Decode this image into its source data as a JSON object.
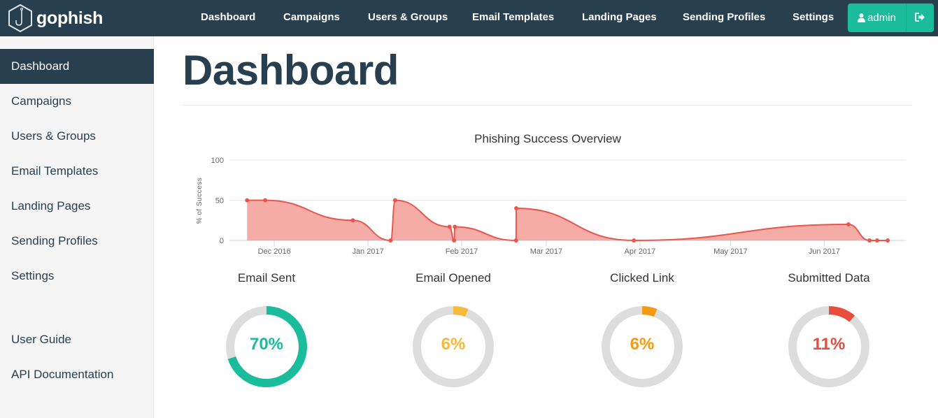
{
  "brand": {
    "name": "gophish",
    "icon": "hexagon-hook-icon"
  },
  "navbar": {
    "links": [
      {
        "label": "Dashboard"
      },
      {
        "label": "Campaigns"
      },
      {
        "label": "Users & Groups"
      },
      {
        "label": "Email Templates"
      },
      {
        "label": "Landing Pages"
      },
      {
        "label": "Sending Profiles"
      },
      {
        "label": "Settings"
      }
    ],
    "user": {
      "label": "admin",
      "icon": "user-icon"
    },
    "logout": {
      "icon": "sign-out-icon"
    }
  },
  "sidebar": {
    "items": [
      {
        "label": "Dashboard",
        "active": true
      },
      {
        "label": "Campaigns"
      },
      {
        "label": "Users & Groups"
      },
      {
        "label": "Email Templates"
      },
      {
        "label": "Landing Pages"
      },
      {
        "label": "Sending Profiles"
      },
      {
        "label": "Settings"
      }
    ],
    "footer_items": [
      {
        "label": "User Guide"
      },
      {
        "label": "API Documentation"
      }
    ]
  },
  "page": {
    "title": "Dashboard"
  },
  "colors": {
    "navy": "#283f50",
    "accent": "#1abc9c",
    "line": "#e8574f",
    "area": "#f4a29c",
    "opened": "#f6b93b",
    "clicked": "#f39c12",
    "submitted": "#e74c3c",
    "track": "#dddddd"
  },
  "chart_data": [
    {
      "type": "area",
      "title": "Phishing Success Overview",
      "xlabel": "",
      "ylabel": "% of Success",
      "ylim": [
        0,
        100
      ],
      "yticks": [
        0,
        50,
        100
      ],
      "xlim": [
        "2016-11-18",
        "2017-06-28"
      ],
      "xticks": [
        {
          "date": "2016-12-01",
          "label": "Dec 2016"
        },
        {
          "date": "2017-01-01",
          "label": "Jan 2017"
        },
        {
          "date": "2017-02-01",
          "label": "Feb 2017"
        },
        {
          "date": "2017-03-01",
          "label": "Mar 2017"
        },
        {
          "date": "2017-04-01",
          "label": "Apr 2017"
        },
        {
          "date": "2017-05-01",
          "label": "May 2017"
        },
        {
          "date": "2017-06-01",
          "label": "Jun 2017"
        }
      ],
      "grid": true,
      "legend": "none",
      "points": [
        {
          "x": "2016-11-22T00:00",
          "y": 50
        },
        {
          "x": "2016-11-28T00:00",
          "y": 50
        },
        {
          "x": "2016-12-27T00:00",
          "y": 25
        },
        {
          "x": "2017-01-08T12:00",
          "y": 0
        },
        {
          "x": "2017-01-10T00:00",
          "y": 50
        },
        {
          "x": "2017-01-28T00:00",
          "y": 17
        },
        {
          "x": "2017-01-29T12:00",
          "y": 0
        },
        {
          "x": "2017-01-29T18:00",
          "y": 17
        },
        {
          "x": "2017-02-19T00:00",
          "y": 0
        },
        {
          "x": "2017-02-19T02:00",
          "y": 40
        },
        {
          "x": "2017-03-30T00:00",
          "y": 0
        },
        {
          "x": "2017-06-09T00:00",
          "y": 20
        },
        {
          "x": "2017-06-16T00:00",
          "y": 0
        },
        {
          "x": "2017-06-18T12:00",
          "y": 0
        },
        {
          "x": "2017-06-22T00:00",
          "y": 0
        }
      ]
    },
    {
      "type": "pie",
      "title": "Email Sent",
      "value_percent": 70,
      "label": "70%",
      "color": "#1abc9c"
    },
    {
      "type": "pie",
      "title": "Email Opened",
      "value_percent": 6,
      "label": "6%",
      "color": "#f6b93b"
    },
    {
      "type": "pie",
      "title": "Clicked Link",
      "value_percent": 6,
      "label": "6%",
      "color": "#f39c12"
    },
    {
      "type": "pie",
      "title": "Submitted Data",
      "value_percent": 11,
      "label": "11%",
      "color": "#e74c3c"
    }
  ]
}
